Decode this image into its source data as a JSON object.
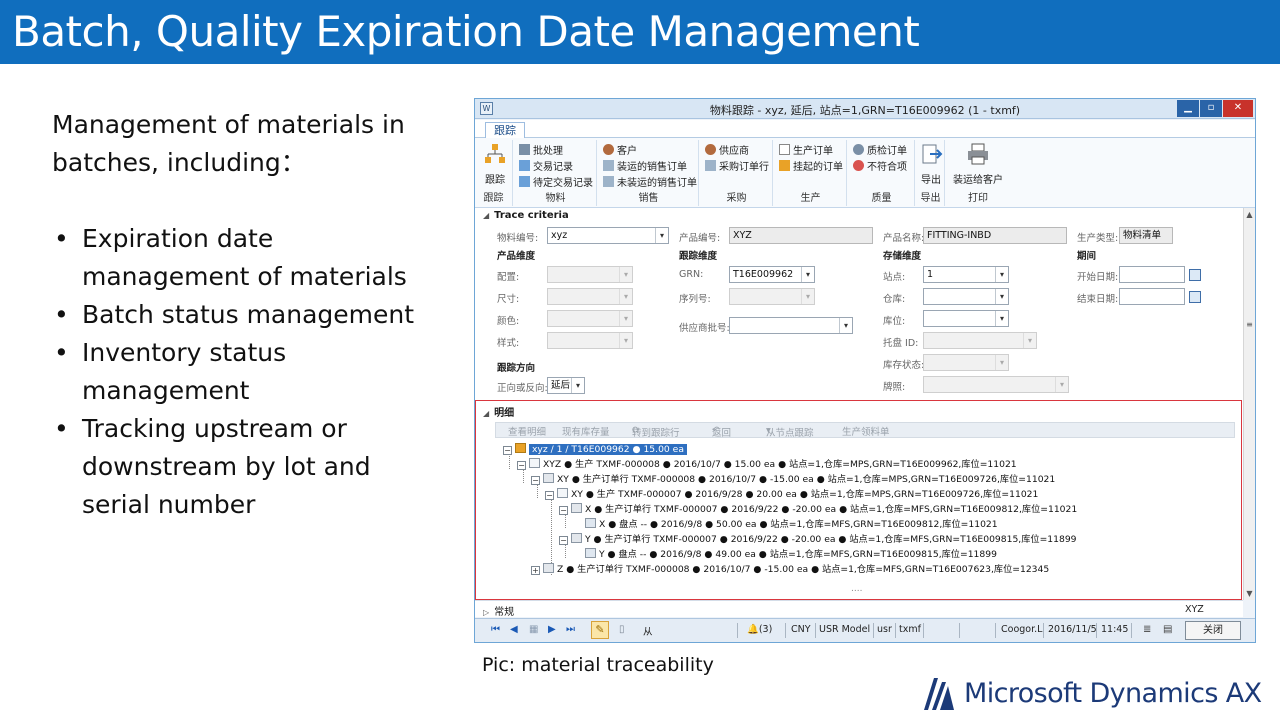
{
  "slide": {
    "title": "Batch, Quality Expiration Date Management",
    "intro": "Management of materials in batches, including：",
    "bullets": [
      "Expiration date management of materials",
      "Batch status management",
      "Inventory status management",
      "Tracking upstream or downstream by lot and serial number"
    ],
    "caption": "Pic: material traceability",
    "logo_text": "Microsoft Dynamics AX",
    "colors": {
      "title_bar": "#106ebe",
      "logo": "#1c3a78",
      "detail_frame": "#d9363e"
    }
  },
  "window": {
    "title": "物料跟踪 - xyz, 延后, 站点=1,GRN=T16E009962 (1 - txmf)",
    "buttons": [
      "minimize-icon",
      "restore-icon",
      "close-icon"
    ],
    "ribbon_tab": "跟踪",
    "ribbon": {
      "trace": {
        "big": "跟踪",
        "label": "跟踪"
      },
      "material": {
        "items": [
          "批处理",
          "交易记录",
          "待定交易记录"
        ],
        "label": "物料"
      },
      "sales": {
        "items": [
          "客户",
          "装运的销售订单",
          "未装运的销售订单"
        ],
        "label": "销售"
      },
      "purchase": {
        "items": [
          "供应商",
          "采购订单行"
        ],
        "label": "采购"
      },
      "production": {
        "items": [
          "生产订单",
          "挂起的订单"
        ],
        "label": "生产"
      },
      "quality": {
        "items": [
          "质检订单",
          "不符合项"
        ],
        "label": "质量"
      },
      "export": {
        "big": "导出",
        "label": "导出"
      },
      "print": {
        "big": "装运给客户",
        "label": "打印"
      }
    },
    "criteria": {
      "section": "Trace criteria",
      "item_no_label": "物料编号:",
      "item_no": "xyz",
      "product_no_label": "产品编号:",
      "product_no": "XYZ",
      "product_name_label": "产品名称:",
      "product_name": "FITTING-INBD",
      "product_type_label": "生产类型:",
      "product_type": "物料清单",
      "dim_product": "产品维度",
      "dim_tracking": "跟踪维度",
      "dim_storage": "存储维度",
      "period": "期间",
      "config_label": "配置:",
      "size_label": "尺寸:",
      "color_label": "颜色:",
      "style_label": "样式:",
      "grn_label": "GRN:",
      "grn": "T16E009962",
      "serial_label": "序列号:",
      "vendor_batch_label": "供应商批号:",
      "site_label": "站点:",
      "site": "1",
      "warehouse_label": "仓库:",
      "location_label": "库位:",
      "pallet_label": "托盘 ID:",
      "inv_status_label": "库存状态:",
      "license_label": "牌照:",
      "start_label": "开始日期:",
      "end_label": "结束日期:",
      "direction_head": "跟踪方向",
      "direction_label": "正向或反向:",
      "direction": "延后"
    },
    "detail": {
      "section": "明细",
      "toolbar": [
        "查看明细",
        "现有库存量",
        "转到跟踪行",
        "返回",
        "从节点跟踪",
        "生产领料单"
      ],
      "tree": [
        "xyz / 1 / T16E009962  ●  15.00 ea",
        "XYZ  ●  生产 TXMF-000008  ●  2016/10/7  ●  15.00 ea  ●  站点=1,仓库=MPS,GRN=T16E009962,库位=11021",
        "XY  ●  生产订单行 TXMF-000008  ●  2016/10/7  ●  -15.00 ea  ●  站点=1,仓库=MPS,GRN=T16E009726,库位=11021",
        "XY  ●  生产 TXMF-000007  ●  2016/9/28  ●  20.00 ea  ●  站点=1,仓库=MPS,GRN=T16E009726,库位=11021",
        "X  ●  生产订单行 TXMF-000007  ●  2016/9/22  ●  -20.00 ea  ●  站点=1,仓库=MFS,GRN=T16E009812,库位=11021",
        "X  ●  盘点 --  ●  2016/9/8  ●  50.00 ea  ●  站点=1,仓库=MFS,GRN=T16E009812,库位=11021",
        "Y  ●  生产订单行 TXMF-000007  ●  2016/9/22  ●  -20.00 ea  ●  站点=1,仓库=MFS,GRN=T16E009815,库位=11899",
        "Y  ●  盘点 --  ●  2016/9/8  ●  49.00 ea  ●  站点=1,仓库=MFS,GRN=T16E009815,库位=11899",
        "Z  ●  生产订单行 TXMF-000008  ●  2016/10/7  ●  -15.00 ea  ●  站点=1,仓库=MFS,GRN=T16E007623,库位=12345"
      ],
      "more": "...."
    },
    "general": {
      "section": "常规",
      "right_value": "XYZ"
    },
    "status": {
      "form": "从",
      "notifications": "(3)",
      "currency": "CNY",
      "model": "USR Model",
      "layer": "usr",
      "company": "txmf",
      "user": "Coogor.L",
      "date": "2016/11/5",
      "time": "11:45",
      "close": "关闭"
    }
  }
}
